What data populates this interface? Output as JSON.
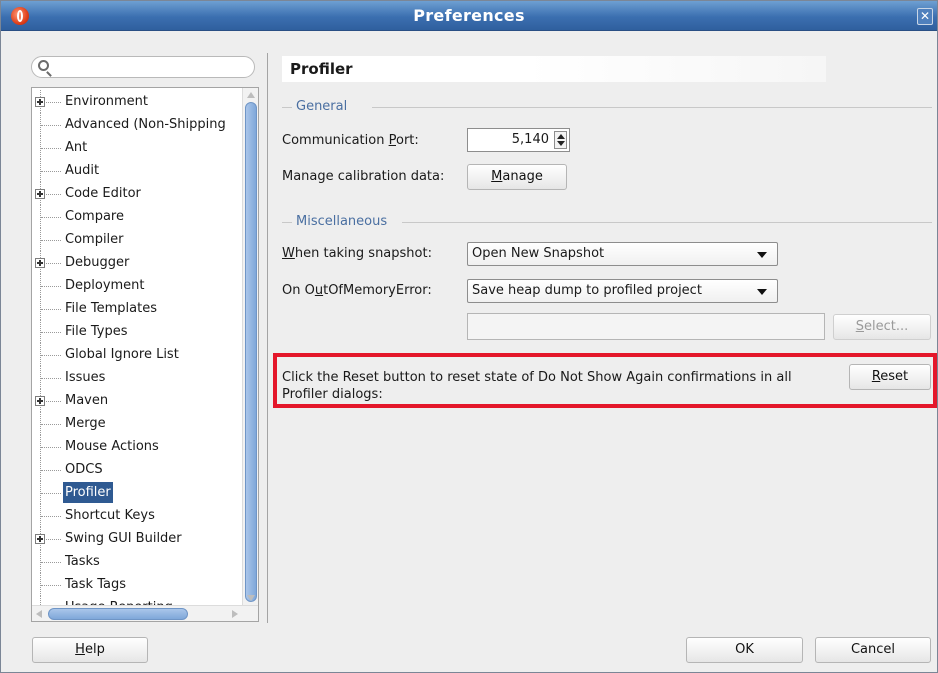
{
  "window": {
    "title": "Preferences",
    "close_glyph": "✕"
  },
  "search": {
    "placeholder": "",
    "icon": "search-icon"
  },
  "tree": {
    "items": [
      {
        "label": "Environment",
        "expandable": true
      },
      {
        "label": "Advanced (Non-Shipping",
        "expandable": false
      },
      {
        "label": "Ant",
        "expandable": false
      },
      {
        "label": "Audit",
        "expandable": false
      },
      {
        "label": "Code Editor",
        "expandable": true
      },
      {
        "label": "Compare",
        "expandable": false
      },
      {
        "label": "Compiler",
        "expandable": false
      },
      {
        "label": "Debugger",
        "expandable": true
      },
      {
        "label": "Deployment",
        "expandable": false
      },
      {
        "label": "File Templates",
        "expandable": false
      },
      {
        "label": "File Types",
        "expandable": false
      },
      {
        "label": "Global Ignore List",
        "expandable": false
      },
      {
        "label": "Issues",
        "expandable": false
      },
      {
        "label": "Maven",
        "expandable": true
      },
      {
        "label": "Merge",
        "expandable": false
      },
      {
        "label": "Mouse Actions",
        "expandable": false
      },
      {
        "label": "ODCS",
        "expandable": false
      },
      {
        "label": "Profiler",
        "expandable": false,
        "selected": true
      },
      {
        "label": "Shortcut Keys",
        "expandable": false
      },
      {
        "label": "Swing GUI Builder",
        "expandable": true
      },
      {
        "label": "Tasks",
        "expandable": false
      },
      {
        "label": "Task Tags",
        "expandable": false
      },
      {
        "label": "Usage Reporting",
        "expandable": false
      }
    ]
  },
  "panel": {
    "title": "Profiler",
    "general": {
      "caption": "General",
      "port_label_pre": "Communication ",
      "port_label_u": "P",
      "port_label_post": "ort:",
      "port_value": "5,140",
      "calib_label": "Manage calibration data:",
      "manage_u": "M",
      "manage_rest": "anage"
    },
    "misc": {
      "caption": "Miscellaneous",
      "snapshot_label_u": "W",
      "snapshot_label_rest": "hen taking snapshot:",
      "snapshot_value": "Open New Snapshot",
      "oom_label_pre": "On O",
      "oom_label_u": "u",
      "oom_label_post": "tOfMemoryError:",
      "oom_value": "Save heap dump to profiled project",
      "path_value": "",
      "select_u": "S",
      "select_rest": "elect..."
    },
    "reset": {
      "text": "Click the Reset button to reset state of Do Not Show Again confirmations in all Profiler dialogs:",
      "button_u": "R",
      "button_rest": "eset",
      "highlight_color": "#e4162a"
    }
  },
  "footer": {
    "help_u": "H",
    "help_rest": "elp",
    "ok": "OK",
    "cancel": "Cancel"
  }
}
